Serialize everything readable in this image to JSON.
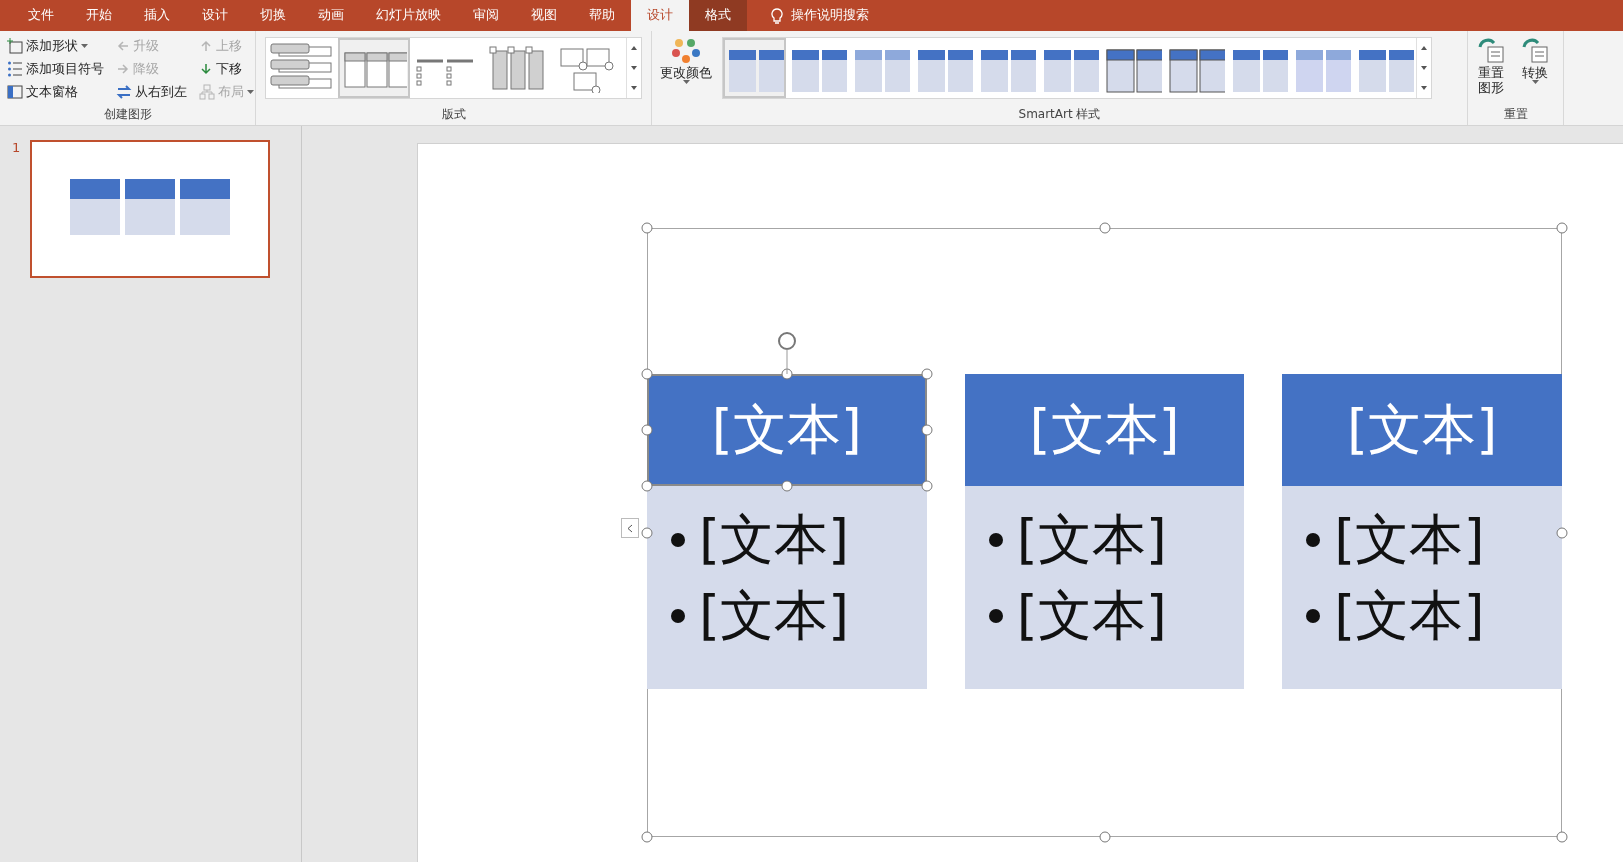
{
  "tabs": [
    {
      "label": "文件",
      "kind": "tab",
      "selected": false
    },
    {
      "label": "开始",
      "kind": "tab",
      "selected": false
    },
    {
      "label": "插入",
      "kind": "tab",
      "selected": false
    },
    {
      "label": "设计",
      "kind": "tab",
      "selected": false
    },
    {
      "label": "切换",
      "kind": "tab",
      "selected": false
    },
    {
      "label": "动画",
      "kind": "tab",
      "selected": false
    },
    {
      "label": "幻灯片放映",
      "kind": "tab",
      "selected": false
    },
    {
      "label": "审阅",
      "kind": "tab",
      "selected": false
    },
    {
      "label": "视图",
      "kind": "tab",
      "selected": false
    },
    {
      "label": "帮助",
      "kind": "tab",
      "selected": false
    },
    {
      "label": "设计",
      "kind": "contextual",
      "selected": true
    },
    {
      "label": "格式",
      "kind": "contextual",
      "selected": false
    }
  ],
  "search": {
    "label": "操作说明搜索"
  },
  "ribbon": {
    "create_graphic": {
      "label": "创建图形",
      "columns": [
        [
          {
            "label": "添加形状",
            "disabled": false,
            "dropdown": true
          },
          {
            "label": "添加项目符号",
            "disabled": false,
            "dropdown": false
          },
          {
            "label": "文本窗格",
            "disabled": false,
            "dropdown": false
          }
        ],
        [
          {
            "label": "升级",
            "disabled": true,
            "dropdown": false
          },
          {
            "label": "降级",
            "disabled": true,
            "dropdown": false
          },
          {
            "label": "从右到左",
            "disabled": false,
            "dropdown": false
          }
        ],
        [
          {
            "label": "上移",
            "disabled": true,
            "dropdown": false
          },
          {
            "label": "下移",
            "disabled": false,
            "dropdown": false
          },
          {
            "label": "布局",
            "disabled": true,
            "dropdown": true
          }
        ]
      ]
    },
    "layouts": {
      "label": "版式",
      "items": [
        {
          "selected": false
        },
        {
          "selected": true
        },
        {
          "selected": false
        },
        {
          "selected": false
        },
        {
          "selected": false
        }
      ]
    },
    "styles": {
      "label": "SmartArt 样式",
      "change_colors": "更改颜色",
      "items": [
        {
          "selected": true
        },
        {
          "selected": false
        },
        {
          "selected": false
        },
        {
          "selected": false
        },
        {
          "selected": false
        },
        {
          "selected": false
        },
        {
          "selected": false
        },
        {
          "selected": false
        },
        {
          "selected": false
        },
        {
          "selected": false
        },
        {
          "selected": false
        }
      ]
    },
    "reset": {
      "label": "重置",
      "buttons": [
        {
          "label": "重置图形",
          "dropdown": false
        },
        {
          "label": "转换",
          "dropdown": true
        }
      ]
    }
  },
  "slides": [
    {
      "number": "1",
      "selected": true
    }
  ],
  "diagram": {
    "columns": [
      {
        "header": "[文本]",
        "selected": true,
        "bullets": [
          "[文本]",
          "[文本]"
        ]
      },
      {
        "header": "[文本]",
        "selected": false,
        "bullets": [
          "[文本]",
          "[文本]"
        ]
      },
      {
        "header": "[文本]",
        "selected": false,
        "bullets": [
          "[文本]",
          "[文本]"
        ]
      }
    ]
  }
}
